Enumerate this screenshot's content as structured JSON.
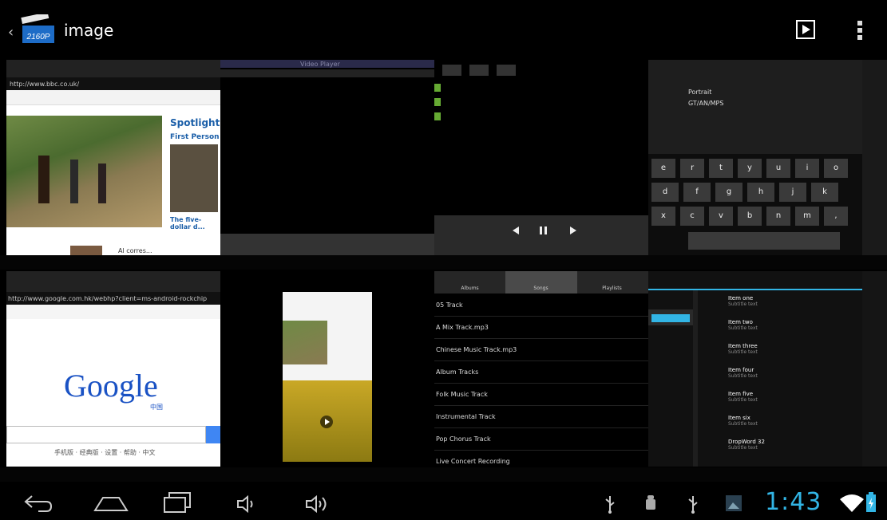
{
  "app": {
    "title": "image",
    "logo_text": "2160P",
    "back_glyph": "‹"
  },
  "actions": {
    "play_icon": "play-icon",
    "overflow_icon": "overflow-menu-icon"
  },
  "thumbs": {
    "browser": {
      "url": "http://www.bbc.co.uk/",
      "spotlight": "Spotlight",
      "first_person": "First Person",
      "caption": "The five-dollar d...",
      "bottom_caption": "Al corres..."
    },
    "player_top": {
      "caption": "Video Player"
    },
    "google": {
      "url": "http://www.google.com.hk/webhp?client=ms-android-rockchip",
      "logo": "Google",
      "logo_sub": "中国",
      "footer": "手机版 · 经典版 · 设置 · 帮助 · 中文"
    },
    "music": {
      "tabs": [
        "Albums",
        "Songs",
        "Playlists"
      ],
      "songs": [
        "05 Track",
        "A Mix Track.mp3",
        "Chinese Music Track.mp3",
        "Album Tracks",
        "Folk Music Track",
        "Instrumental Track",
        "Pop Chorus Track",
        "Live Concert Recording"
      ]
    },
    "settings": {
      "label1": "Portrait",
      "label2": "GT/AN/MPS",
      "items": [
        {
          "title": "Item one",
          "sub": "Subtitle text"
        },
        {
          "title": "Item two",
          "sub": "Subtitle text"
        },
        {
          "title": "Item three",
          "sub": "Subtitle text"
        },
        {
          "title": "Item four",
          "sub": "Subtitle text"
        },
        {
          "title": "Item five",
          "sub": "Subtitle text"
        },
        {
          "title": "Item six",
          "sub": "Subtitle text"
        },
        {
          "title": "DropWord 32",
          "sub": "Subtitle text"
        }
      ]
    },
    "keyboard": {
      "row1": [
        "e",
        "r",
        "t",
        "y",
        "u",
        "i",
        "o"
      ],
      "row2": [
        "d",
        "f",
        "g",
        "h",
        "j",
        "k"
      ],
      "row3": [
        "x",
        "c",
        "v",
        "b",
        "n",
        "m",
        ","
      ]
    }
  },
  "status": {
    "clock": "1:43"
  },
  "nav": {
    "back_icon": "back-icon",
    "home_icon": "home-icon",
    "recents_icon": "recent-apps-icon",
    "vol_down_icon": "volume-down-icon",
    "vol_up_icon": "volume-up-icon"
  },
  "colors": {
    "accent": "#32b5e5",
    "background": "#000000"
  }
}
